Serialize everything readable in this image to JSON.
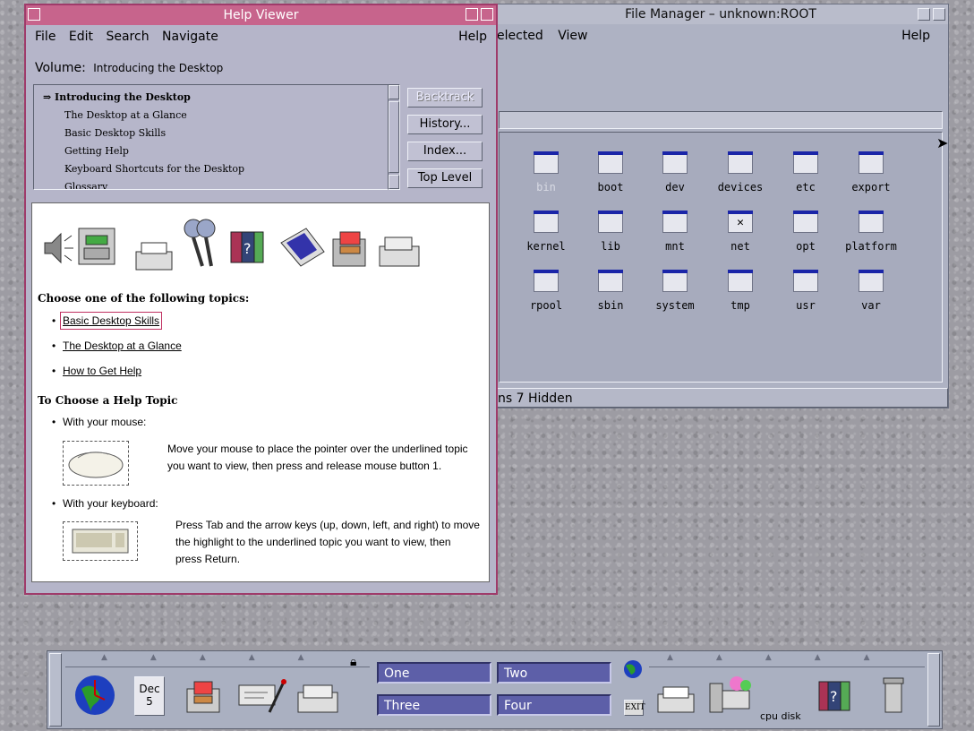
{
  "file_manager": {
    "title": "File Manager – unknown:ROOT",
    "menu": [
      "elected",
      "View"
    ],
    "help": "Help",
    "files": [
      "bin",
      "boot",
      "dev",
      "devices",
      "etc",
      "export",
      "kernel",
      "lib",
      "mnt",
      "net",
      "opt",
      "platform",
      "rpool",
      "sbin",
      "system",
      "tmp",
      "usr",
      "var"
    ],
    "status": "ns 7 Hidden"
  },
  "help_viewer": {
    "title": "Help Viewer",
    "menu": {
      "file": "File",
      "edit": "Edit",
      "search": "Search",
      "navigate": "Navigate",
      "help": "Help"
    },
    "volume_label": "Volume:",
    "volume_name": "Introducing the Desktop",
    "topics": [
      "⇒ Introducing the Desktop",
      "The Desktop at a Glance",
      "Basic Desktop Skills",
      "Getting Help",
      "Keyboard Shortcuts for the Desktop",
      "Glossary"
    ],
    "buttons": {
      "backtrack": "Backtrack",
      "history": "History...",
      "index": "Index...",
      "top_level": "Top Level"
    },
    "content": {
      "choose_heading": "Choose one of the following topics:",
      "links": [
        "Basic Desktop Skills",
        "The Desktop at a Glance",
        "How to Get Help"
      ],
      "choose_topic_heading": "To Choose a Help Topic",
      "mouse_label": "With your mouse:",
      "mouse_text": "Move your mouse to place the pointer over the underlined topic you want to view, then press and release mouse button 1.",
      "keyboard_label": "With your keyboard:",
      "keyboard_text": "Press Tab and the arrow keys (up, down, left, and right) to move the highlight to the underlined topic you want to view, then press Return."
    }
  },
  "front_panel": {
    "calendar_month": "Dec",
    "calendar_day": "5",
    "workspaces": [
      "One",
      "Two",
      "Three",
      "Four"
    ],
    "exit_label": "EXIT",
    "cpu_disk": "cpu disk"
  },
  "colors": {
    "help_title": "#c7648c",
    "workspace": "#5d5fa8",
    "folder_tab": "#1a25a8"
  }
}
